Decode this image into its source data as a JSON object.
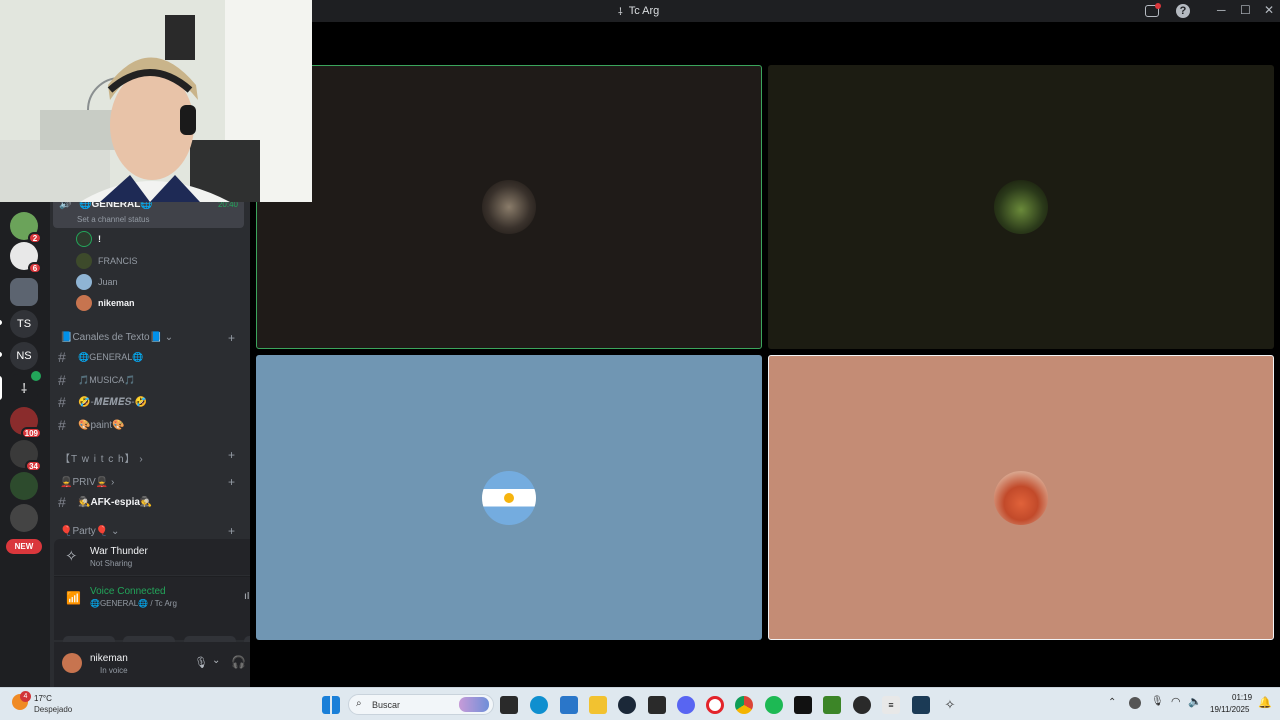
{
  "window": {
    "title": "Tc Arg"
  },
  "servers": [
    {
      "label": "",
      "badge": "2"
    },
    {
      "label": "",
      "badge": "6"
    },
    {
      "label": "",
      "badge": ""
    },
    {
      "label": "TS",
      "badge": ""
    },
    {
      "label": "NS",
      "badge": ""
    },
    {
      "label": "",
      "badge": ""
    },
    {
      "label": "",
      "badge": "109"
    },
    {
      "label": "",
      "badge": "34"
    },
    {
      "label": "",
      "badge": ""
    }
  ],
  "new_badge": "NEW",
  "voice_channel": {
    "name": "🌐GENERAL🌐",
    "time": "20:40",
    "status": "Set a channel status"
  },
  "members": [
    "!",
    "FRANCIS",
    "Juan",
    "nikeman"
  ],
  "text_category": "📘Canales de Texto📘",
  "text_channels": [
    "🌐GENERAL🌐",
    "🎵MUSICA🎵",
    "🤣-𝑴𝑬𝑴𝑬𝑺-🤣",
    "🎨paint🎨"
  ],
  "twitch_category": "【T w i t c h】",
  "priv_category": "💂PRIV💂",
  "priv_channels": [
    "🕵️AFK-espia🕵️"
  ],
  "party_category": "🎈Party🎈",
  "activity": {
    "game": "War Thunder",
    "status": "Not Sharing"
  },
  "voice": {
    "title": "Voice Connected",
    "channel": "🌐GENERAL🌐 / Tc Arg"
  },
  "user": {
    "name": "nikeman",
    "status": "In voice"
  },
  "taskbar": {
    "weather_temp": "17°C",
    "weather_desc": "Despejado",
    "weather_badge": "4",
    "search_placeholder": "Buscar",
    "time": "01:19",
    "date": "19/11/2025"
  },
  "colors": {
    "tile1": "#1f1b18",
    "tile2": "#1c1c12",
    "tile3": "#7096b3",
    "tile4": "#c48c75",
    "speaking": "#3ba55c",
    "voice_green": "#23a55a"
  }
}
